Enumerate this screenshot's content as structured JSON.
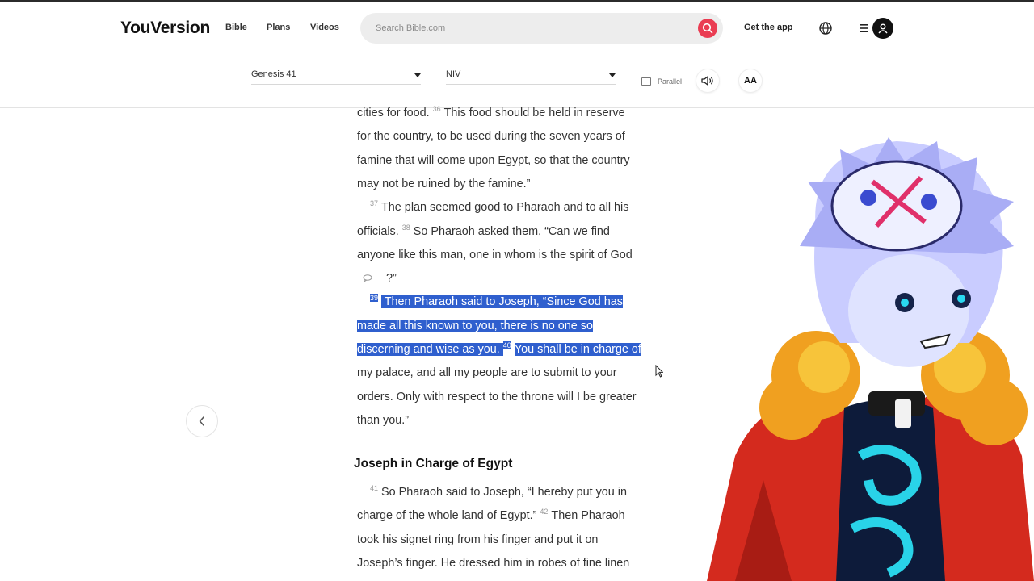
{
  "header": {
    "logo": "YouVersion",
    "nav": [
      "Bible",
      "Plans",
      "Videos"
    ],
    "search_placeholder": "Search Bible.com",
    "get_app": "Get the app"
  },
  "toolbar": {
    "book_chapter": "Genesis 41",
    "version": "NIV",
    "parallel_label": "Parallel",
    "font_size_label": "AA"
  },
  "reader": {
    "lines": [
      [
        {
          "t": "cities for food. "
        },
        {
          "v": "36"
        },
        {
          "t": "This food should be held in reserve"
        }
      ],
      [
        {
          "t": "for the country, to be used during the seven years of"
        }
      ],
      [
        {
          "t": "famine that will come upon Egypt, so that the country"
        }
      ],
      [
        {
          "t": "may not be ruined by the famine.”"
        }
      ],
      [
        {
          "t": "    "
        },
        {
          "v": "37"
        },
        {
          "t": "The plan seemed good to Pharaoh and to all his"
        }
      ],
      [
        {
          "t": "officials. "
        },
        {
          "v": "38"
        },
        {
          "t": "So Pharaoh asked them, “Can we find"
        }
      ],
      [
        {
          "t": "anyone like this man, one in whom is the spirit of God"
        }
      ],
      [
        {
          "t": "         ?”"
        }
      ],
      [
        {
          "t": "    "
        },
        {
          "v": "39",
          "hl": true
        },
        {
          "t": " Then Pharaoh said to Joseph, “Since God has",
          "hl": true
        }
      ],
      [
        {
          "t": "made all this known to you, there is no one so",
          "hl": true
        }
      ],
      [
        {
          "t": "discerning and wise as you. ",
          "hl": true
        },
        {
          "v": "40",
          "hl": true
        },
        {
          "t": "You shall be in charge of",
          "hl": true
        }
      ],
      [
        {
          "t": "my palace, and all my people are to submit to your"
        }
      ],
      [
        {
          "t": "orders. Only with respect to the throne will I be greater"
        }
      ],
      [
        {
          "t": "than you.”"
        }
      ]
    ],
    "heading": "Joseph in Charge of Egypt",
    "lines2": [
      [
        {
          "t": "    "
        },
        {
          "v": "41"
        },
        {
          "t": "So Pharaoh said to Joseph, “I hereby put you in"
        }
      ],
      [
        {
          "t": "charge of the whole land of Egypt.” "
        },
        {
          "v": "42"
        },
        {
          "t": "Then Pharaoh"
        }
      ],
      [
        {
          "t": "took his signet ring from his finger and put it on"
        }
      ],
      [
        {
          "t": "Joseph’s finger. He dressed him in robes of fine linen"
        }
      ]
    ]
  },
  "icons": {
    "search": "search-icon",
    "globe": "globe-icon",
    "menu": "hamburger-menu-icon",
    "account": "user-avatar-icon",
    "audio": "speaker-icon",
    "prev": "chevron-left-icon",
    "note": "comment-note-icon"
  },
  "colors": {
    "accent_red": "#ea3c52",
    "highlight_blue": "#2f5fce"
  }
}
